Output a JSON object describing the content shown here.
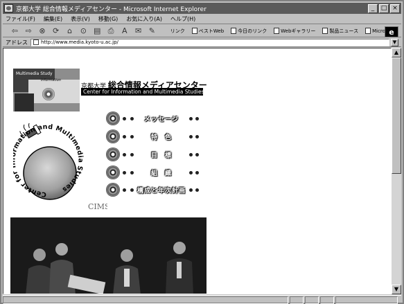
{
  "window": {
    "title": "京都大学 総合情報メディアセンター - Microsoft Internet Explorer",
    "controls": {
      "minimize": "_",
      "maximize": "□",
      "close": "×"
    }
  },
  "menubar": {
    "items": [
      "ファイル(F)",
      "編集(E)",
      "表示(V)",
      "移動(G)",
      "お気に入り(A)",
      "ヘルプ(H)"
    ]
  },
  "toolbar": {
    "buttons": [
      "back-icon",
      "forward-icon",
      "stop-icon",
      "refresh-icon",
      "home-icon",
      "search-icon",
      "favorites-icon",
      "print-icon",
      "font-icon",
      "mail-icon",
      "edit-icon"
    ],
    "links_label": "リンク",
    "links": [
      "ベストWeb",
      "今日のリンク",
      "Webギャラリー",
      "製品ニュース",
      "Microsoft"
    ],
    "brand_logo": "e"
  },
  "address": {
    "label": "アドレス",
    "url": "http://www.media.kyoto-u.ac.jp/"
  },
  "page": {
    "collage_text1": "Multimedia Study",
    "collage_text2": "information",
    "university": "京都大学",
    "center_jp": "総合情報メディアセンター",
    "center_en": "Center for Information and Multimedia Studies",
    "logo_ring_text": "Center for Information and Multimedia Studies",
    "logo_abbrev": "CIMS",
    "menu": [
      {
        "label": "メッセージ"
      },
      {
        "label": "特　色"
      },
      {
        "label": "目　標"
      },
      {
        "label": "組　織"
      },
      {
        "label": "構成と年次計画"
      }
    ]
  },
  "colors": {
    "titlebar": "#5a5a5a",
    "chrome": "#c0c0c0",
    "page_bg": "#ffffff"
  }
}
